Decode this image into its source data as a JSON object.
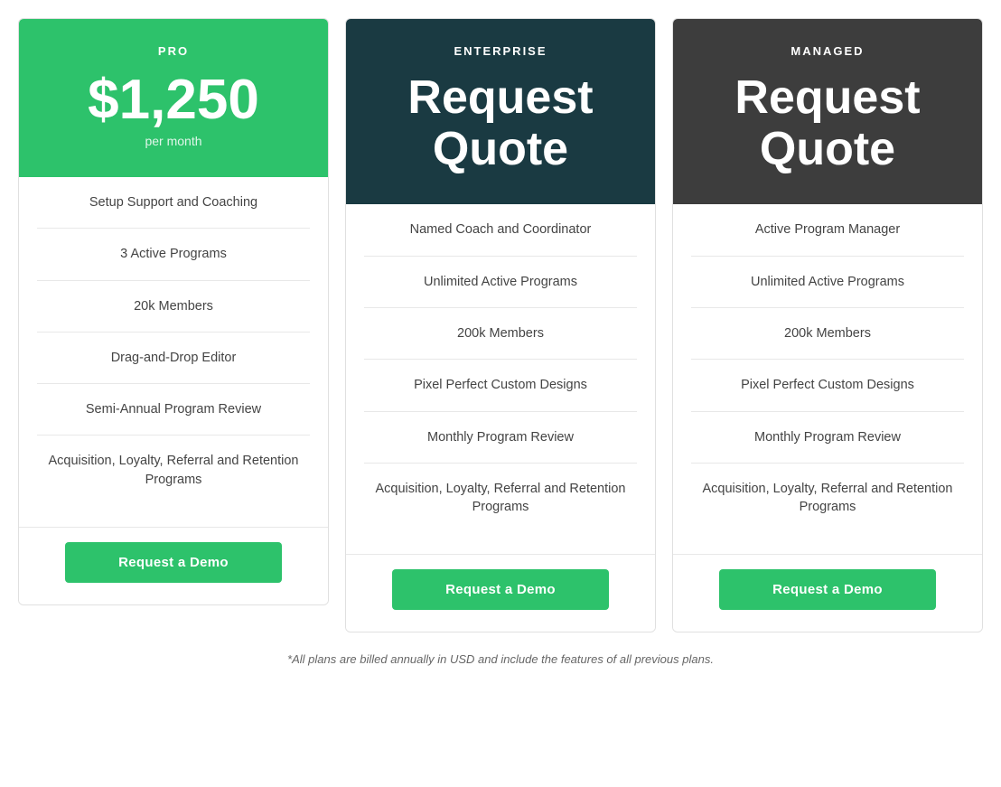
{
  "plans": [
    {
      "id": "pro",
      "name": "PRO",
      "headerClass": "pro",
      "priceType": "fixed",
      "priceValue": "$1,250",
      "pricePeriod": "per month",
      "features": [
        "Setup Support and Coaching",
        "3 Active Programs",
        "20k Members",
        "Drag-and-Drop Editor",
        "Semi-Annual Program Review",
        "Acquisition, Loyalty, Referral and Retention Programs"
      ],
      "cta": "Request a Demo"
    },
    {
      "id": "enterprise",
      "name": "ENTERPRISE",
      "headerClass": "enterprise",
      "priceType": "quote",
      "priceValue": "Request Quote",
      "features": [
        "Named Coach and Coordinator",
        "Unlimited Active Programs",
        "200k Members",
        "Pixel Perfect Custom Designs",
        "Monthly Program Review",
        "Acquisition, Loyalty, Referral and Retention Programs"
      ],
      "cta": "Request a Demo"
    },
    {
      "id": "managed",
      "name": "MANAGED",
      "headerClass": "managed",
      "priceType": "quote",
      "priceValue": "Request Quote",
      "features": [
        "Active Program Manager",
        "Unlimited Active Programs",
        "200k Members",
        "Pixel Perfect Custom Designs",
        "Monthly Program Review",
        "Acquisition, Loyalty, Referral and Retention Programs"
      ],
      "cta": "Request a Demo"
    }
  ],
  "footnote": "*All plans are billed annually in USD and include the features of all previous plans."
}
